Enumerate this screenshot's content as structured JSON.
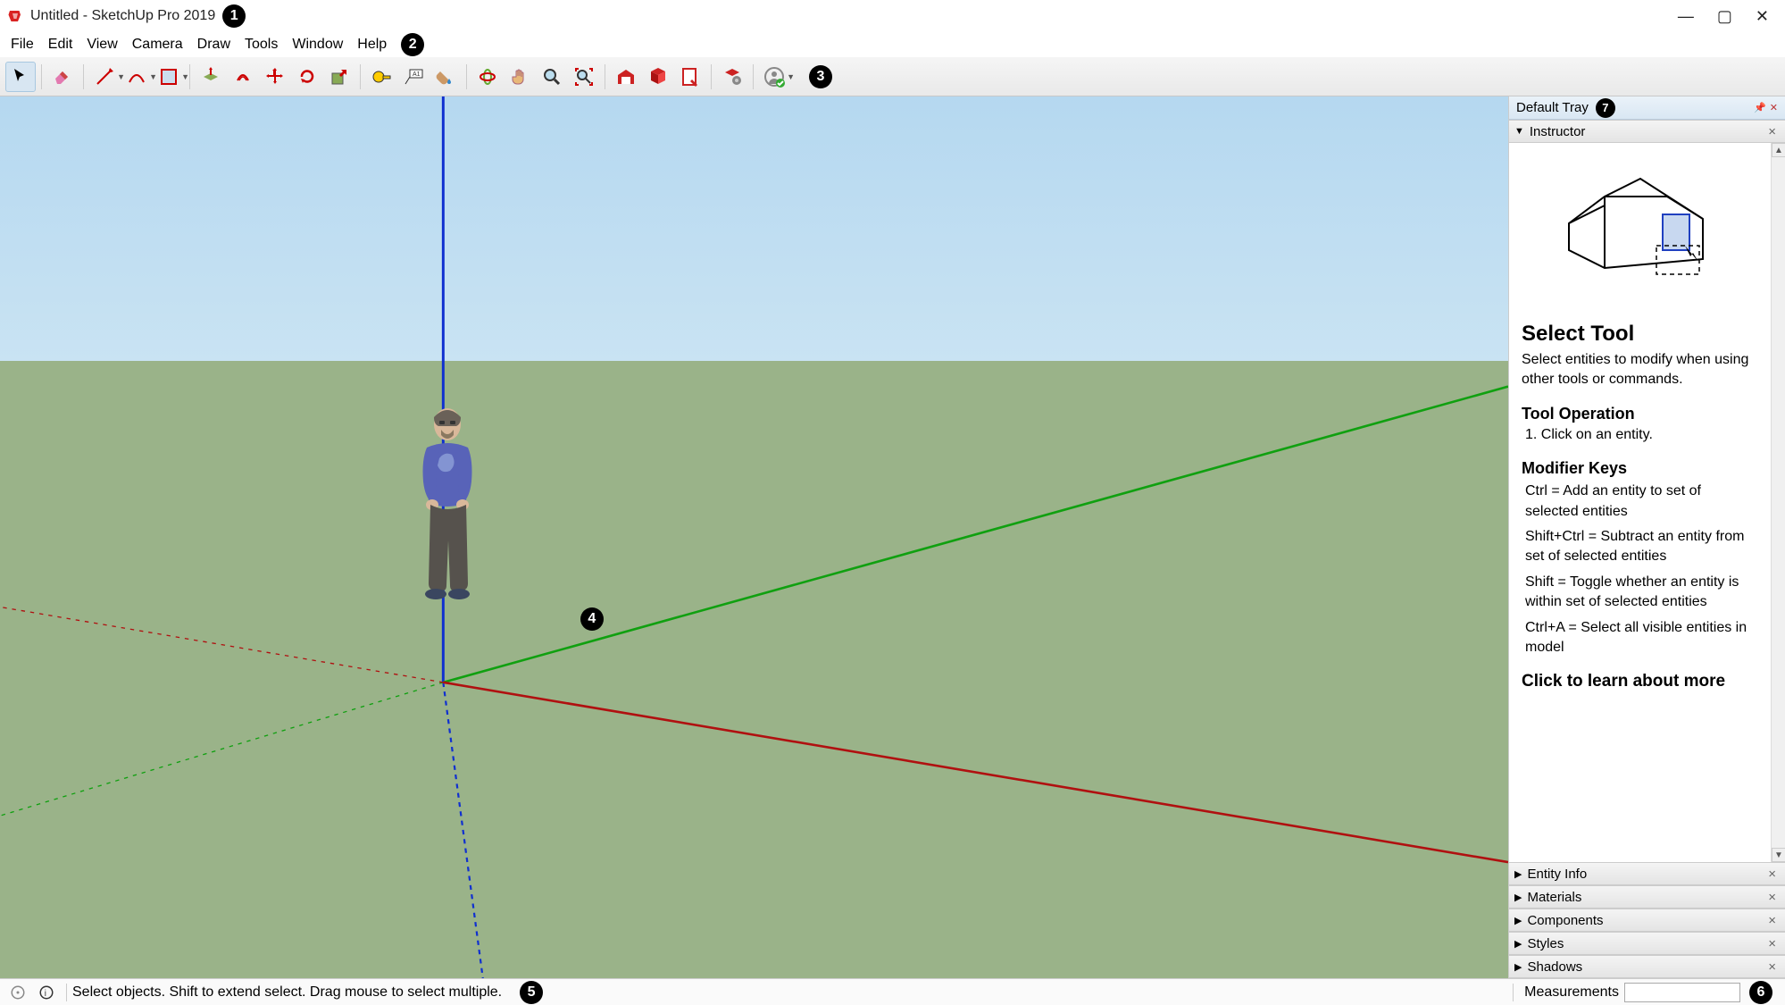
{
  "title": "Untitled - SketchUp Pro 2019",
  "window_controls": {
    "minimize": "—",
    "maximize": "▢",
    "close": "✕"
  },
  "menu": [
    "File",
    "Edit",
    "View",
    "Camera",
    "Draw",
    "Tools",
    "Window",
    "Help"
  ],
  "toolbar_icons": [
    "select",
    "eraser",
    "pencil",
    "arc",
    "rectangle",
    "pushpull",
    "offset",
    "move",
    "rotate",
    "scale",
    "tape",
    "text",
    "paint",
    "orbit",
    "pan",
    "zoom",
    "zoom-extents",
    "warehouse",
    "components",
    "layout",
    "ruby",
    "user"
  ],
  "tray": {
    "title": "Default Tray",
    "instructor": {
      "label": "Instructor",
      "heading": "Select Tool",
      "description": "Select entities to modify when using other tools or commands.",
      "operation_heading": "Tool Operation",
      "operation_step": "1. Click on an entity.",
      "modifier_heading": "Modifier Keys",
      "modifier_ctrl": "Ctrl = Add an entity to set of selected entities",
      "modifier_shiftctrl": "Shift+Ctrl = Subtract an entity from set of selected entities",
      "modifier_shift": "Shift = Toggle whether an entity is within set of selected entities",
      "modifier_ctrla": "Ctrl+A = Select all visible entities in model",
      "learn_more": "Click to learn about more"
    },
    "panels": [
      "Entity Info",
      "Materials",
      "Components",
      "Styles",
      "Shadows"
    ]
  },
  "statusbar": {
    "message": "Select objects. Shift to extend select. Drag mouse to select multiple.",
    "measurements_label": "Measurements"
  },
  "annotations": {
    "b1": "1",
    "b2": "2",
    "b3": "3",
    "b4": "4",
    "b5": "5",
    "b6": "6",
    "b7": "7"
  }
}
